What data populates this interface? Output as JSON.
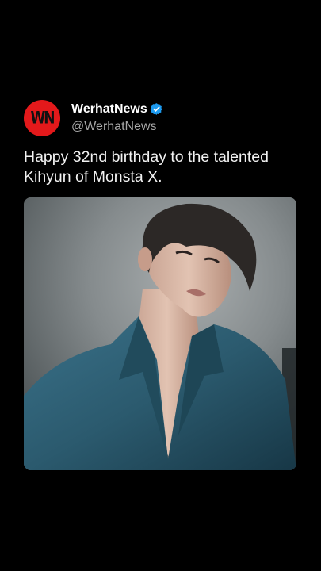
{
  "post": {
    "avatar_text": "WN",
    "display_name": "WerhatNews",
    "handle": "@WerhatNews",
    "text": "Happy 32nd birthday to the talented Kihyun of Monsta X.",
    "verified_icon": "verified-badge-icon",
    "colors": {
      "avatar_bg": "#e3191b",
      "verified": "#1d9bf0",
      "background": "#000000"
    }
  },
  "photo": {
    "subject": "portrait-photo",
    "colors": {
      "backdrop": "#868c8e",
      "jacket": "#2b5a6e",
      "hair": "#2c2826",
      "skin": "#d8b8a6"
    }
  }
}
